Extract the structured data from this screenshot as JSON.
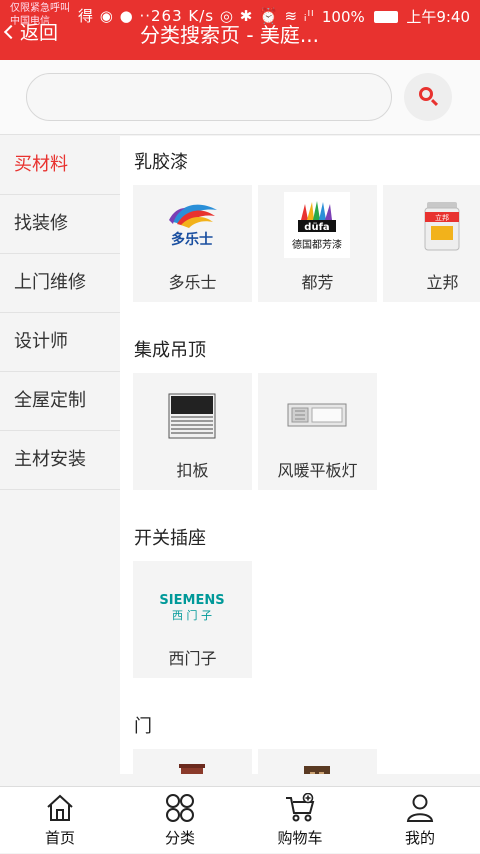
{
  "status_bar": {
    "carrier_line1": "仅限紧急呼叫",
    "carrier_line2": "中国电信",
    "icons_text": "得 ◉ ● ··263 K/s ◎ ✱ ⏰ ≋ ᵢˡˡ",
    "battery": "100%",
    "time": "上午9:40"
  },
  "header": {
    "back_label": "返回",
    "title": "分类搜索页 - 美庭..."
  },
  "search": {
    "value": "",
    "placeholder": ""
  },
  "sidebar": {
    "items": [
      {
        "label": "买材料",
        "active": true
      },
      {
        "label": "找装修"
      },
      {
        "label": "上门维修"
      },
      {
        "label": "设计师"
      },
      {
        "label": "全屋定制"
      },
      {
        "label": "主材安装"
      }
    ]
  },
  "sections": [
    {
      "title": "乳胶漆",
      "items": [
        {
          "label": "多乐士",
          "logo_text": "多乐士"
        },
        {
          "label": "都芳",
          "logo_text": "德国都芳漆",
          "logo_badge": "düfa"
        },
        {
          "label": "立邦",
          "logo_text": "立邦"
        }
      ]
    },
    {
      "title": "集成吊顶",
      "items": [
        {
          "label": "扣板"
        },
        {
          "label": "风暖平板灯"
        }
      ]
    },
    {
      "title": "开关插座",
      "items": [
        {
          "label": "西门子",
          "logo_text": "SIEMENS",
          "logo_text2": "西 门 子"
        }
      ]
    },
    {
      "title": "门",
      "items": [
        {
          "label": ""
        },
        {
          "label": ""
        }
      ]
    }
  ],
  "tabbar": {
    "items": [
      {
        "label": "首页",
        "icon": "home-icon"
      },
      {
        "label": "分类",
        "icon": "category-icon"
      },
      {
        "label": "购物车",
        "icon": "cart-icon"
      },
      {
        "label": "我的",
        "icon": "user-icon"
      }
    ]
  },
  "colors": {
    "brand_red": "#e8322f",
    "siemens_teal": "#009999"
  }
}
